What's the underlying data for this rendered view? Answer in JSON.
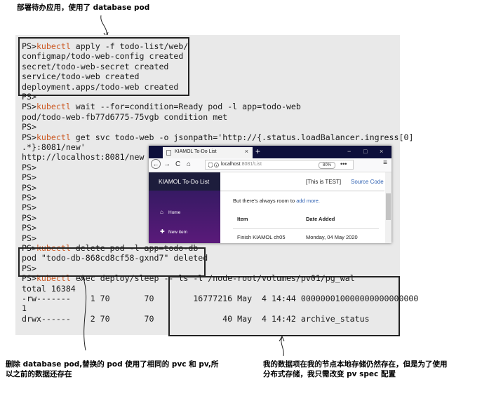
{
  "annotations": {
    "top": "部署待办应用，使用了 database pod",
    "bottom_left_line1": "删除 database pod,替换的 pod 使用了相同的 pvc 和 pv,所",
    "bottom_left_line2": "以之前的数据还存在",
    "bottom_right_line1": "我的数据项在我的节点本地存储仍然存在，但是为了使用",
    "bottom_right_line2": "分布式存储，我只需改变 pv spec 配置"
  },
  "terminal": {
    "lines": [
      {
        "prompt": "PS>",
        "cmd": "kubectl",
        "rest": " apply -f todo-list/web/"
      },
      {
        "prompt": "",
        "cmd": "",
        "rest": "configmap/todo-web-config created"
      },
      {
        "prompt": "",
        "cmd": "",
        "rest": "secret/todo-web-secret created"
      },
      {
        "prompt": "",
        "cmd": "",
        "rest": "service/todo-web created"
      },
      {
        "prompt": "",
        "cmd": "",
        "rest": "deployment.apps/todo-web created"
      },
      {
        "prompt": "PS>",
        "cmd": "",
        "rest": ""
      },
      {
        "prompt": "PS>",
        "cmd": "kubectl",
        "rest": " wait --for=condition=Ready pod -l app=todo-web"
      },
      {
        "prompt": "",
        "cmd": "",
        "rest": "pod/todo-web-fb77d6775-75vgb condition met"
      },
      {
        "prompt": "PS>",
        "cmd": "",
        "rest": ""
      },
      {
        "prompt": "PS>",
        "cmd": "kubectl",
        "rest": " get svc todo-web -o jsonpath='http://{.status.loadBalancer.ingress[0]"
      },
      {
        "prompt": "",
        "cmd": "",
        "rest": ".*}:8081/new'"
      },
      {
        "prompt": "",
        "cmd": "",
        "rest": "http://localhost:8081/new"
      },
      {
        "prompt": "PS>",
        "cmd": "",
        "rest": ""
      },
      {
        "prompt": "PS>",
        "cmd": "",
        "rest": ""
      },
      {
        "prompt": "PS>",
        "cmd": "",
        "rest": ""
      },
      {
        "prompt": "PS>",
        "cmd": "",
        "rest": ""
      },
      {
        "prompt": "PS>",
        "cmd": "",
        "rest": ""
      },
      {
        "prompt": "PS>",
        "cmd": "",
        "rest": ""
      },
      {
        "prompt": "PS>",
        "cmd": "",
        "rest": ""
      },
      {
        "prompt": "PS>",
        "cmd": "",
        "rest": ""
      },
      {
        "prompt": "PS>",
        "cmd": "kubectl",
        "rest": " delete pod -l app=todo-db"
      },
      {
        "prompt": "",
        "cmd": "",
        "rest": "pod \"todo-db-868cd8cf58-gxnd7\" deleted"
      },
      {
        "prompt": "PS>",
        "cmd": "",
        "rest": ""
      },
      {
        "prompt": "PS>",
        "cmd": "kubectl",
        "rest": " exec deploy/sleep -- ls -l /node-root/volumes/pv01/pg_wal"
      },
      {
        "prompt": "",
        "cmd": "",
        "rest": "total 16384"
      },
      {
        "prompt": "",
        "cmd": "",
        "rest": "-rw-------    1 70       70        16777216 May  4 14:44 000000010000000000000000"
      },
      {
        "prompt": "",
        "cmd": "",
        "rest": "1"
      },
      {
        "prompt": "",
        "cmd": "",
        "rest": "drwx------    2 70       70              40 May  4 14:42 archive_status"
      }
    ]
  },
  "browser": {
    "tab_title": "KIAMOL To-Do List",
    "tab_close": "×",
    "new_tab": "+",
    "min": "−",
    "max": "□",
    "close": "×",
    "back": "←",
    "forward": "→",
    "reload": "C",
    "home": "⌂",
    "url_host": "localhost",
    "url_path": ":8081/List",
    "zoom": "80%",
    "more": "•••",
    "menu": "≡",
    "sidebar": {
      "title": "KIAMOL To-Do List",
      "items": [
        {
          "icon": "⌂",
          "label": "Home"
        },
        {
          "icon": "✚",
          "label": "New item"
        }
      ]
    },
    "env_label": "[This is TEST]",
    "source_link": "Source Code",
    "room_text": "But there's always room to ",
    "add_link": "add more.",
    "table": {
      "headers": [
        "Item",
        "Date Added"
      ],
      "rows": [
        [
          "Finish KIAMOL ch05",
          "Monday, 04 May 2020"
        ]
      ]
    }
  },
  "colors": {
    "terminal_bg": "#e9e9e9",
    "command": "#cc5a24",
    "browser_tabbar": "#0d0f3b",
    "sidebar_header": "#1d1d3c",
    "link": "#2a5db0"
  }
}
